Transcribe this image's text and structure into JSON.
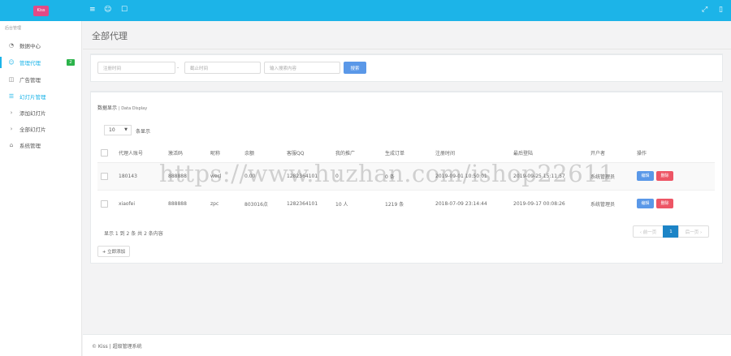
{
  "app": {
    "logo_text": "Kiss"
  },
  "topbar": {
    "left_icons": [
      "menu-icon",
      "user-icon",
      "lock-icon"
    ],
    "right_icons": [
      "fullscreen-icon",
      "mobile-icon"
    ]
  },
  "sidebar": {
    "heading": "后台管理",
    "items": [
      {
        "label": "数据中心",
        "icon": "dashboard-icon"
      },
      {
        "label": "管理代理",
        "icon": "user-icon",
        "badge": "2"
      },
      {
        "label": "广告管理",
        "icon": "ad-icon"
      },
      {
        "label": "幻灯片管理",
        "icon": "slides-icon"
      },
      {
        "label": "添加幻灯片",
        "icon": "chevron-right-icon"
      },
      {
        "label": "全部幻灯片",
        "icon": "chevron-right-icon"
      },
      {
        "label": "系统管理",
        "icon": "home-icon"
      }
    ]
  },
  "page": {
    "title": "全部代理"
  },
  "search": {
    "start_placeholder": "注册时间",
    "separator": "-",
    "end_placeholder": "截止时间",
    "keyword_placeholder": "输入搜索内容",
    "button_label": "搜索"
  },
  "list": {
    "title": "数据显示",
    "subtitle": "| Data Display",
    "page_length": "10",
    "page_length_suffix": "条显示",
    "columns": [
      "",
      "代理人账号",
      "激活码",
      "昵称",
      "余额",
      "客服QQ",
      "我的推广",
      "生成订单",
      "注册时间",
      "最后登陆",
      "开户者",
      "操作"
    ],
    "rows": [
      {
        "account": "180143",
        "code": "888888",
        "nickname": "wecl",
        "balance": "0.00",
        "qq": "1282364101",
        "promo": "0",
        "orders": "0 条",
        "register": "2019-09-01 10:50:01",
        "last_login": "2019-09-25 15:11:57",
        "creator": "系统管理员"
      },
      {
        "account": "xiaofei",
        "code": "888888",
        "nickname": "zpc",
        "balance": "803016点",
        "qq": "1282364101",
        "promo": "10 人",
        "orders": "1219 条",
        "register": "2018-07-09 23:14:44",
        "last_login": "2019-09-17 00:08:26",
        "creator": "系统管理员"
      }
    ],
    "edit_label": "编辑",
    "delete_label": "删除",
    "info": "显示 1 到 2 条 共 2 条内容",
    "pager": {
      "prev": "‹ 前一页",
      "current": "1",
      "next": "后一页 ›"
    },
    "add_label": "+ 立即添加"
  },
  "footer": {
    "text": "© Kiss | 超级管理系统"
  },
  "watermark": "https://www.huzhan.com/ishop22611"
}
